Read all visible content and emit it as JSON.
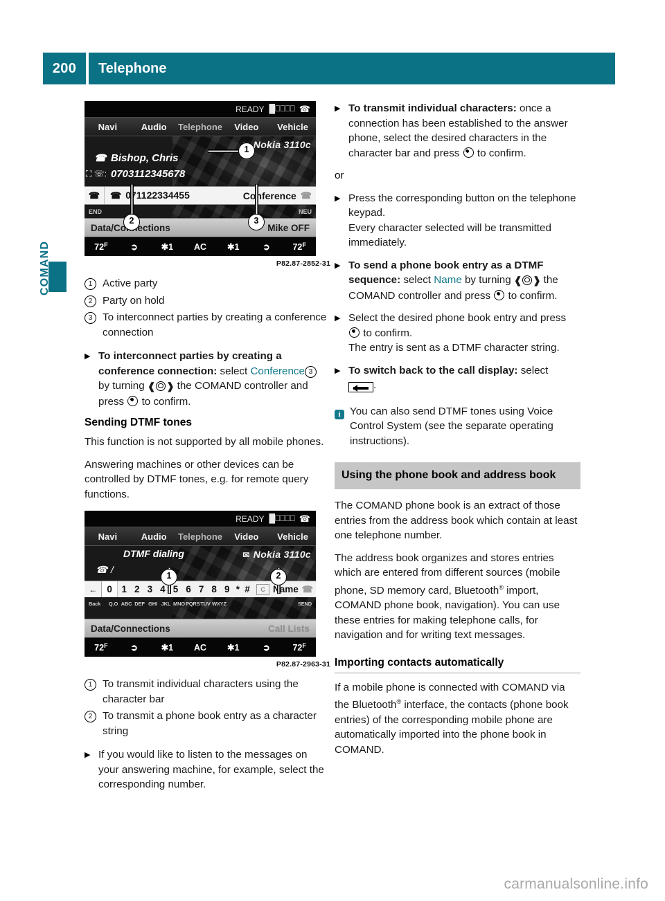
{
  "header": {
    "page_number": "200",
    "title": "Telephone"
  },
  "margin_tab": {
    "label": "COMAND"
  },
  "colors": {
    "teal": "#0b7286",
    "section_header_bg": "#c6c6c6",
    "watermark": "#a8a8a8"
  },
  "figure1": {
    "caption": "P82.87-2852-31",
    "status": {
      "ready": "READY",
      "signal": "█⎕⎕⎕⎕",
      "handset_icon": "phone-icon"
    },
    "menu": [
      "Navi",
      "Audio",
      "Telephone",
      "Video",
      "Vehicle"
    ],
    "menu_selected": "Telephone",
    "device_name": "Nokia 3110c",
    "active_name": "Bishop, Chris",
    "active_number_label": ":",
    "active_number": "0703112345678",
    "hold_number": "071122334455",
    "conference_label": "Conference",
    "soft_left": "END",
    "soft_right": "NEU",
    "bottom_left": "Data/Connections",
    "bottom_right": "Mike OFF",
    "climate": [
      "72",
      "seat-icon",
      "1",
      "AC",
      "1",
      "seat-icon",
      "72"
    ],
    "climate_left_temp": "72",
    "climate_right_temp": "72",
    "climate_deg": "F",
    "fan_left": "1",
    "fan_center": "AC",
    "fan_right": "1",
    "callouts": [
      "1",
      "2",
      "3"
    ]
  },
  "figure2": {
    "caption": "P82.87-2963-31",
    "status": {
      "ready": "READY",
      "signal": "█⎕⎕⎕⎕",
      "handset_icon": "phone-icon"
    },
    "menu": [
      "Navi",
      "Audio",
      "Telephone",
      "Video",
      "Vehicle"
    ],
    "menu_selected": "Telephone",
    "title": "DTMF dialing",
    "device_name": "Nokia 3110c",
    "input_value": "/",
    "charbar": {
      "back_icon": "left-arrow-icon",
      "zero": "0",
      "keys": [
        "1",
        "2",
        "3",
        "4",
        "5",
        "6",
        "7",
        "8",
        "9",
        "*",
        "#"
      ],
      "clear": "C",
      "name": "Name"
    },
    "letters": {
      "back": "Back",
      "groups": [
        "Q.O",
        "ABC",
        "DEF",
        "GHI",
        "JKL",
        "MNO",
        "PQRS",
        "TUV",
        "WXYZ"
      ],
      "send": "SEND"
    },
    "bottom_left": "Data/Connections",
    "bottom_right": "Call Lists",
    "climate_left_temp": "72",
    "climate_right_temp": "72",
    "climate_deg": "F",
    "fan_left": "1",
    "fan_center": "AC",
    "fan_right": "1",
    "callouts": [
      "1",
      "2"
    ]
  },
  "left_column": {
    "legend1": [
      {
        "num": "1",
        "text": "Active party"
      },
      {
        "num": "2",
        "text": "Party on hold"
      },
      {
        "num": "3",
        "text": "To interconnect parties by creating a conference connection"
      }
    ],
    "step1": {
      "bold": "To interconnect parties by creating a conference connection:",
      "after_bold": " select ",
      "teal_word": "Conference",
      "callout_num": "3",
      "mid": " by turning ",
      "mid2": " the COMAND controller and press ",
      "end": " to confirm."
    },
    "heading_dtmf": "Sending DTMF tones",
    "para_dtmf_1": "This function is not supported by all mobile phones.",
    "para_dtmf_2": "Answering machines or other devices can be controlled by DTMF tones, e.g. for remote query functions.",
    "legend2": [
      {
        "num": "1",
        "text": "To transmit individual characters using the character bar"
      },
      {
        "num": "2",
        "text": "To transmit a phone book entry as a character string"
      }
    ],
    "step2": "If you would like to listen to the messages on your answering machine, for example, select the corresponding number."
  },
  "right_column": {
    "step_transmit": {
      "bold": "To transmit individual characters:",
      "text": " once a connection has been established to the answer phone, select the desired characters in the character bar and press ",
      "end": " to confirm."
    },
    "or_label": "or",
    "step_keypad": {
      "text": "Press the corresponding button on the telephone keypad.",
      "sub": "Every character selected will be transmitted immediately."
    },
    "step_send_entry": {
      "bold": "To send a phone book entry as a DTMF sequence:",
      "after_bold": " select ",
      "teal_word": "Name",
      "mid": " by turning ",
      "mid2": " the COMAND controller and press ",
      "end": " to confirm."
    },
    "step_select_entry": {
      "text_a": "Select the desired phone book entry and press ",
      "text_b": " to confirm.",
      "sub": "The entry is sent as a DTMF character string."
    },
    "step_switch_back": {
      "bold": "To switch back to the call display:",
      "after_bold": " select ",
      "end": "."
    },
    "note": "You can also send DTMF tones using Voice Control System (see the separate operating instructions).",
    "section_heading": "Using the phone book and address book",
    "para_1": "The COMAND phone book is an extract of those entries from the address book which contain at least one telephone number.",
    "para_2": "The address book organizes and stores entries which are entered from different sources (mobile phone, SD memory card, Bluetooth® import, COMAND phone book, navigation). You can use these entries for making telephone calls, for navigation and for writing text messages.",
    "heading_importing": "Importing contacts automatically",
    "para_3": "If a mobile phone is connected with COMAND via the Bluetooth® interface, the contacts (phone book entries) of the corresponding mobile phone are automatically imported into the phone book in COMAND."
  },
  "footer": {
    "watermark": "carmanualsonline.info"
  }
}
